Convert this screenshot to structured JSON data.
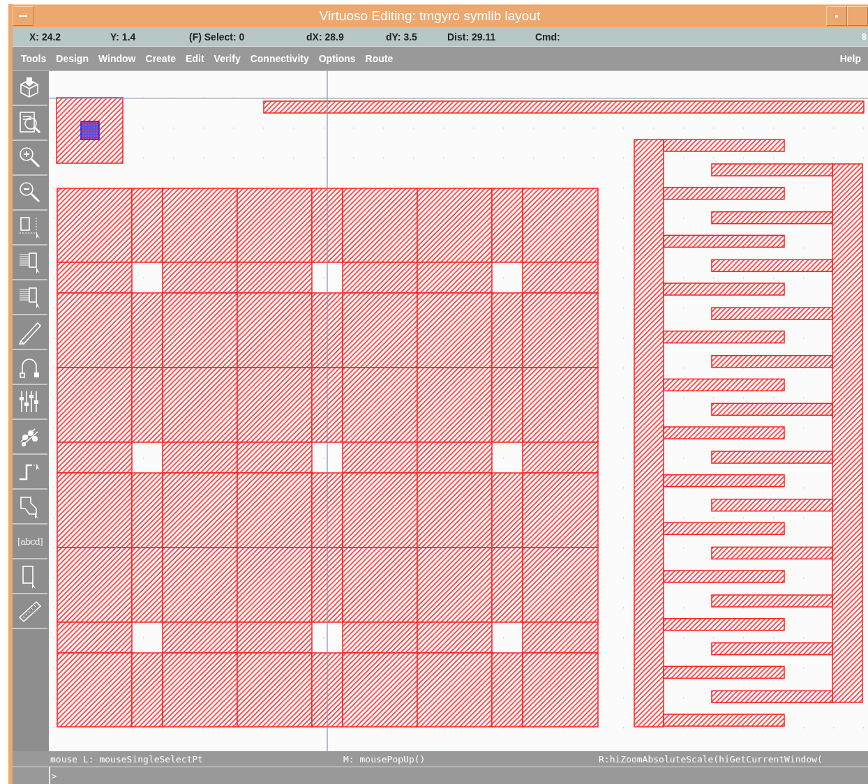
{
  "window": {
    "title": "Virtuoso Editing: tmgyro symlib layout"
  },
  "coordinate_bar": {
    "fields": [
      "X:  24.2",
      "Y:  1.4",
      "(F) Select: 0",
      "dX:  28.9",
      "dY:  3.5",
      "Dist: 29.11",
      "Cmd:"
    ],
    "corner": "8"
  },
  "menu_bar": {
    "items": [
      "Tools",
      "Design",
      "Window",
      "Create",
      "Edit",
      "Verify",
      "Connectivity",
      "Options",
      "Route"
    ],
    "help": "Help"
  },
  "toolbar": [
    {
      "kind": "box"
    },
    {
      "kind": "document"
    },
    {
      "kind": "zoom-in"
    },
    {
      "kind": "zoom-out"
    },
    {
      "kind": "select"
    },
    {
      "kind": "stack"
    },
    {
      "kind": "stack"
    },
    {
      "kind": "pencil"
    },
    {
      "kind": "arc"
    },
    {
      "kind": "sliders"
    },
    {
      "kind": "chip"
    },
    {
      "kind": "step"
    },
    {
      "kind": "polygon"
    },
    {
      "kind": "label",
      "text": "[abcd]"
    },
    {
      "kind": "rectangle"
    },
    {
      "kind": "ruler"
    }
  ],
  "mouse_bar": {
    "left": "mouse L: mouseSingleSelectPt",
    "middle": "M: mousePopUp()",
    "right": "R:hiZoomAbsoluteScale(hiGetCurrentWindow("
  },
  "command_line": {
    "prompt": ">"
  }
}
